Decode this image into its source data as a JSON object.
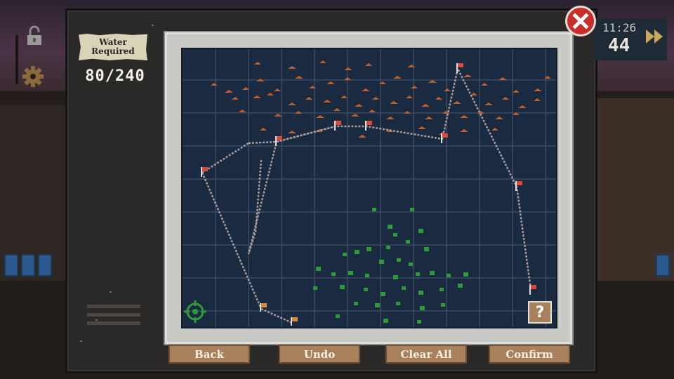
{
  "hud": {
    "water_label": "Water Required",
    "water_count": "80/240",
    "time": "11:26",
    "day": "44"
  },
  "buttons": {
    "back": "Back",
    "undo": "Undo",
    "clear_all": "Clear All",
    "confirm": "Confirm",
    "help": "?"
  },
  "icons": {
    "close": "close-icon",
    "lock": "padlock-icon",
    "gear": "gear-icon",
    "fast_forward": "fast-forward-icon",
    "home_marker": "crosshair-icon",
    "waypoint": "flag-icon"
  },
  "colors": {
    "map_bg": "#1a2a40",
    "grid": "#3a4a60",
    "mountains": "#c0602c",
    "forest": "#2f9a3a",
    "route": "#a89a9a",
    "button": "#a8815c",
    "close": "#c92e2a"
  }
}
